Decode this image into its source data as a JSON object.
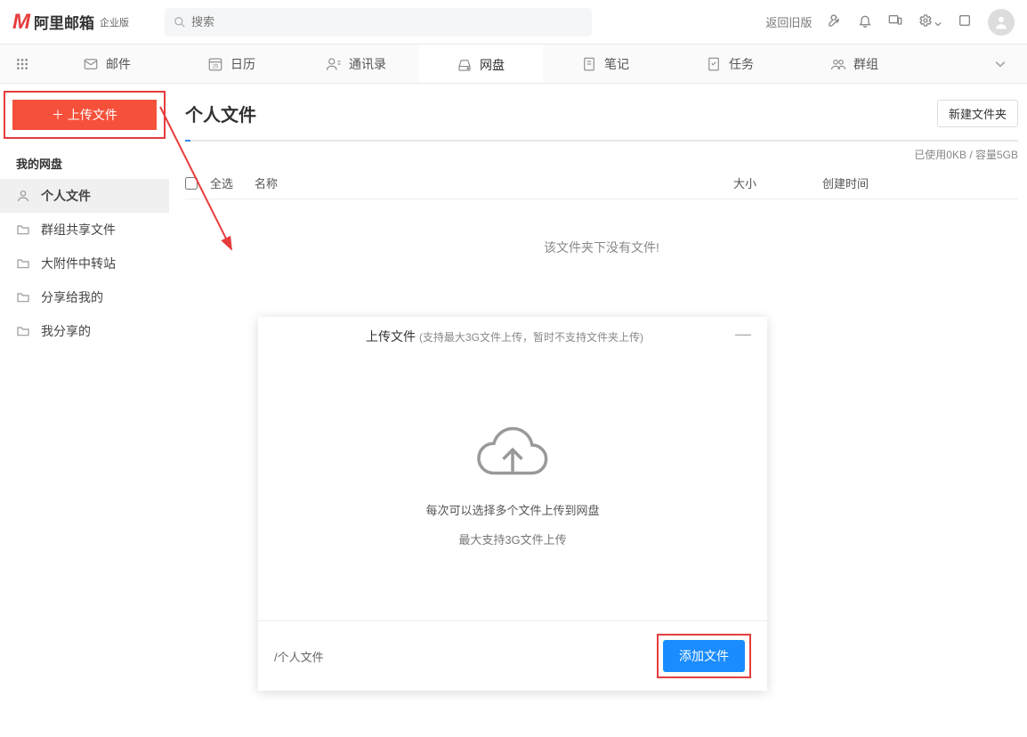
{
  "header": {
    "logo_letter": "M",
    "logo_text": "阿里邮箱",
    "logo_sub": "企业版",
    "search_placeholder": "搜索",
    "back_old": "返回旧版"
  },
  "nav": {
    "items": [
      {
        "label": "邮件"
      },
      {
        "label": "日历",
        "badge": "25"
      },
      {
        "label": "通讯录"
      },
      {
        "label": "网盘"
      },
      {
        "label": "笔记"
      },
      {
        "label": "任务"
      },
      {
        "label": "群组"
      }
    ]
  },
  "sidebar": {
    "upload_btn": "＋ 上传文件",
    "section_title": "我的网盘",
    "items": [
      {
        "label": "个人文件"
      },
      {
        "label": "群组共享文件"
      },
      {
        "label": "大附件中转站"
      },
      {
        "label": "分享给我的"
      },
      {
        "label": "我分享的"
      }
    ]
  },
  "content": {
    "title": "个人文件",
    "new_folder": "新建文件夹",
    "usage": "已使用0KB / 容量5GB",
    "th_all": "全选",
    "th_name": "名称",
    "th_size": "大小",
    "th_time": "创建时间",
    "empty": "该文件夹下没有文件!"
  },
  "modal": {
    "title": "上传文件",
    "title_sub": "(支持最大3G文件上传，暂时不支持文件夹上传)",
    "hint1": "每次可以选择多个文件上传到网盘",
    "hint2": "最大支持3G文件上传",
    "path": "/个人文件",
    "add_btn": "添加文件"
  }
}
